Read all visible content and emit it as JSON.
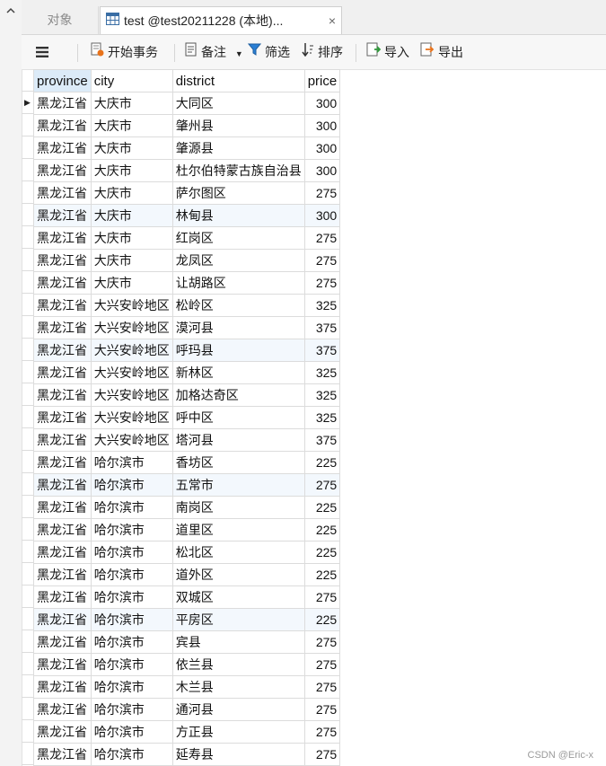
{
  "tabs": {
    "objects_label": "对象",
    "active_label": "test @test20211228 (本地)...",
    "close_glyph": "×"
  },
  "toolbar": {
    "begin_transaction": "开始事务",
    "note": "备注",
    "filter": "筛选",
    "sort": "排序",
    "import": "导入",
    "export": "导出"
  },
  "table": {
    "columns": [
      "province",
      "city",
      "district",
      "price"
    ],
    "selected_column": "province",
    "rows": [
      [
        "黑龙江省",
        "大庆市",
        "大同区",
        "300"
      ],
      [
        "黑龙江省",
        "大庆市",
        "肇州县",
        "300"
      ],
      [
        "黑龙江省",
        "大庆市",
        "肇源县",
        "300"
      ],
      [
        "黑龙江省",
        "大庆市",
        "杜尔伯特蒙古族自治县",
        "300"
      ],
      [
        "黑龙江省",
        "大庆市",
        "萨尔图区",
        "275"
      ],
      [
        "黑龙江省",
        "大庆市",
        "林甸县",
        "300"
      ],
      [
        "黑龙江省",
        "大庆市",
        "红岗区",
        "275"
      ],
      [
        "黑龙江省",
        "大庆市",
        "龙凤区",
        "275"
      ],
      [
        "黑龙江省",
        "大庆市",
        "让胡路区",
        "275"
      ],
      [
        "黑龙江省",
        "大兴安岭地区",
        "松岭区",
        "325"
      ],
      [
        "黑龙江省",
        "大兴安岭地区",
        "漠河县",
        "375"
      ],
      [
        "黑龙江省",
        "大兴安岭地区",
        "呼玛县",
        "375"
      ],
      [
        "黑龙江省",
        "大兴安岭地区",
        "新林区",
        "325"
      ],
      [
        "黑龙江省",
        "大兴安岭地区",
        "加格达奇区",
        "325"
      ],
      [
        "黑龙江省",
        "大兴安岭地区",
        "呼中区",
        "325"
      ],
      [
        "黑龙江省",
        "大兴安岭地区",
        "塔河县",
        "375"
      ],
      [
        "黑龙江省",
        "哈尔滨市",
        "香坊区",
        "225"
      ],
      [
        "黑龙江省",
        "哈尔滨市",
        "五常市",
        "275"
      ],
      [
        "黑龙江省",
        "哈尔滨市",
        "南岗区",
        "225"
      ],
      [
        "黑龙江省",
        "哈尔滨市",
        "道里区",
        "225"
      ],
      [
        "黑龙江省",
        "哈尔滨市",
        "松北区",
        "225"
      ],
      [
        "黑龙江省",
        "哈尔滨市",
        "道外区",
        "225"
      ],
      [
        "黑龙江省",
        "哈尔滨市",
        "双城区",
        "275"
      ],
      [
        "黑龙江省",
        "哈尔滨市",
        "平房区",
        "225"
      ],
      [
        "黑龙江省",
        "哈尔滨市",
        "宾县",
        "275"
      ],
      [
        "黑龙江省",
        "哈尔滨市",
        "依兰县",
        "275"
      ],
      [
        "黑龙江省",
        "哈尔滨市",
        "木兰县",
        "275"
      ],
      [
        "黑龙江省",
        "哈尔滨市",
        "通河县",
        "275"
      ],
      [
        "黑龙江省",
        "哈尔滨市",
        "方正县",
        "275"
      ],
      [
        "黑龙江省",
        "哈尔滨市",
        "延寿县",
        "275"
      ]
    ],
    "current_row_index": 0
  },
  "watermark": "CSDN @Eric-x",
  "icons": {
    "collapse": "chevron-up-icon",
    "menu": "hamburger-icon",
    "table": "table-icon",
    "transaction": "transaction-icon",
    "note": "note-icon",
    "filter": "filter-icon",
    "sort": "sort-icon",
    "import": "import-icon",
    "export": "export-icon"
  },
  "colors": {
    "selected_header": "#dcebf8",
    "alt_row": "#f3f8fd",
    "accent_orange": "#e8731b",
    "accent_blue": "#2a7fd4"
  }
}
